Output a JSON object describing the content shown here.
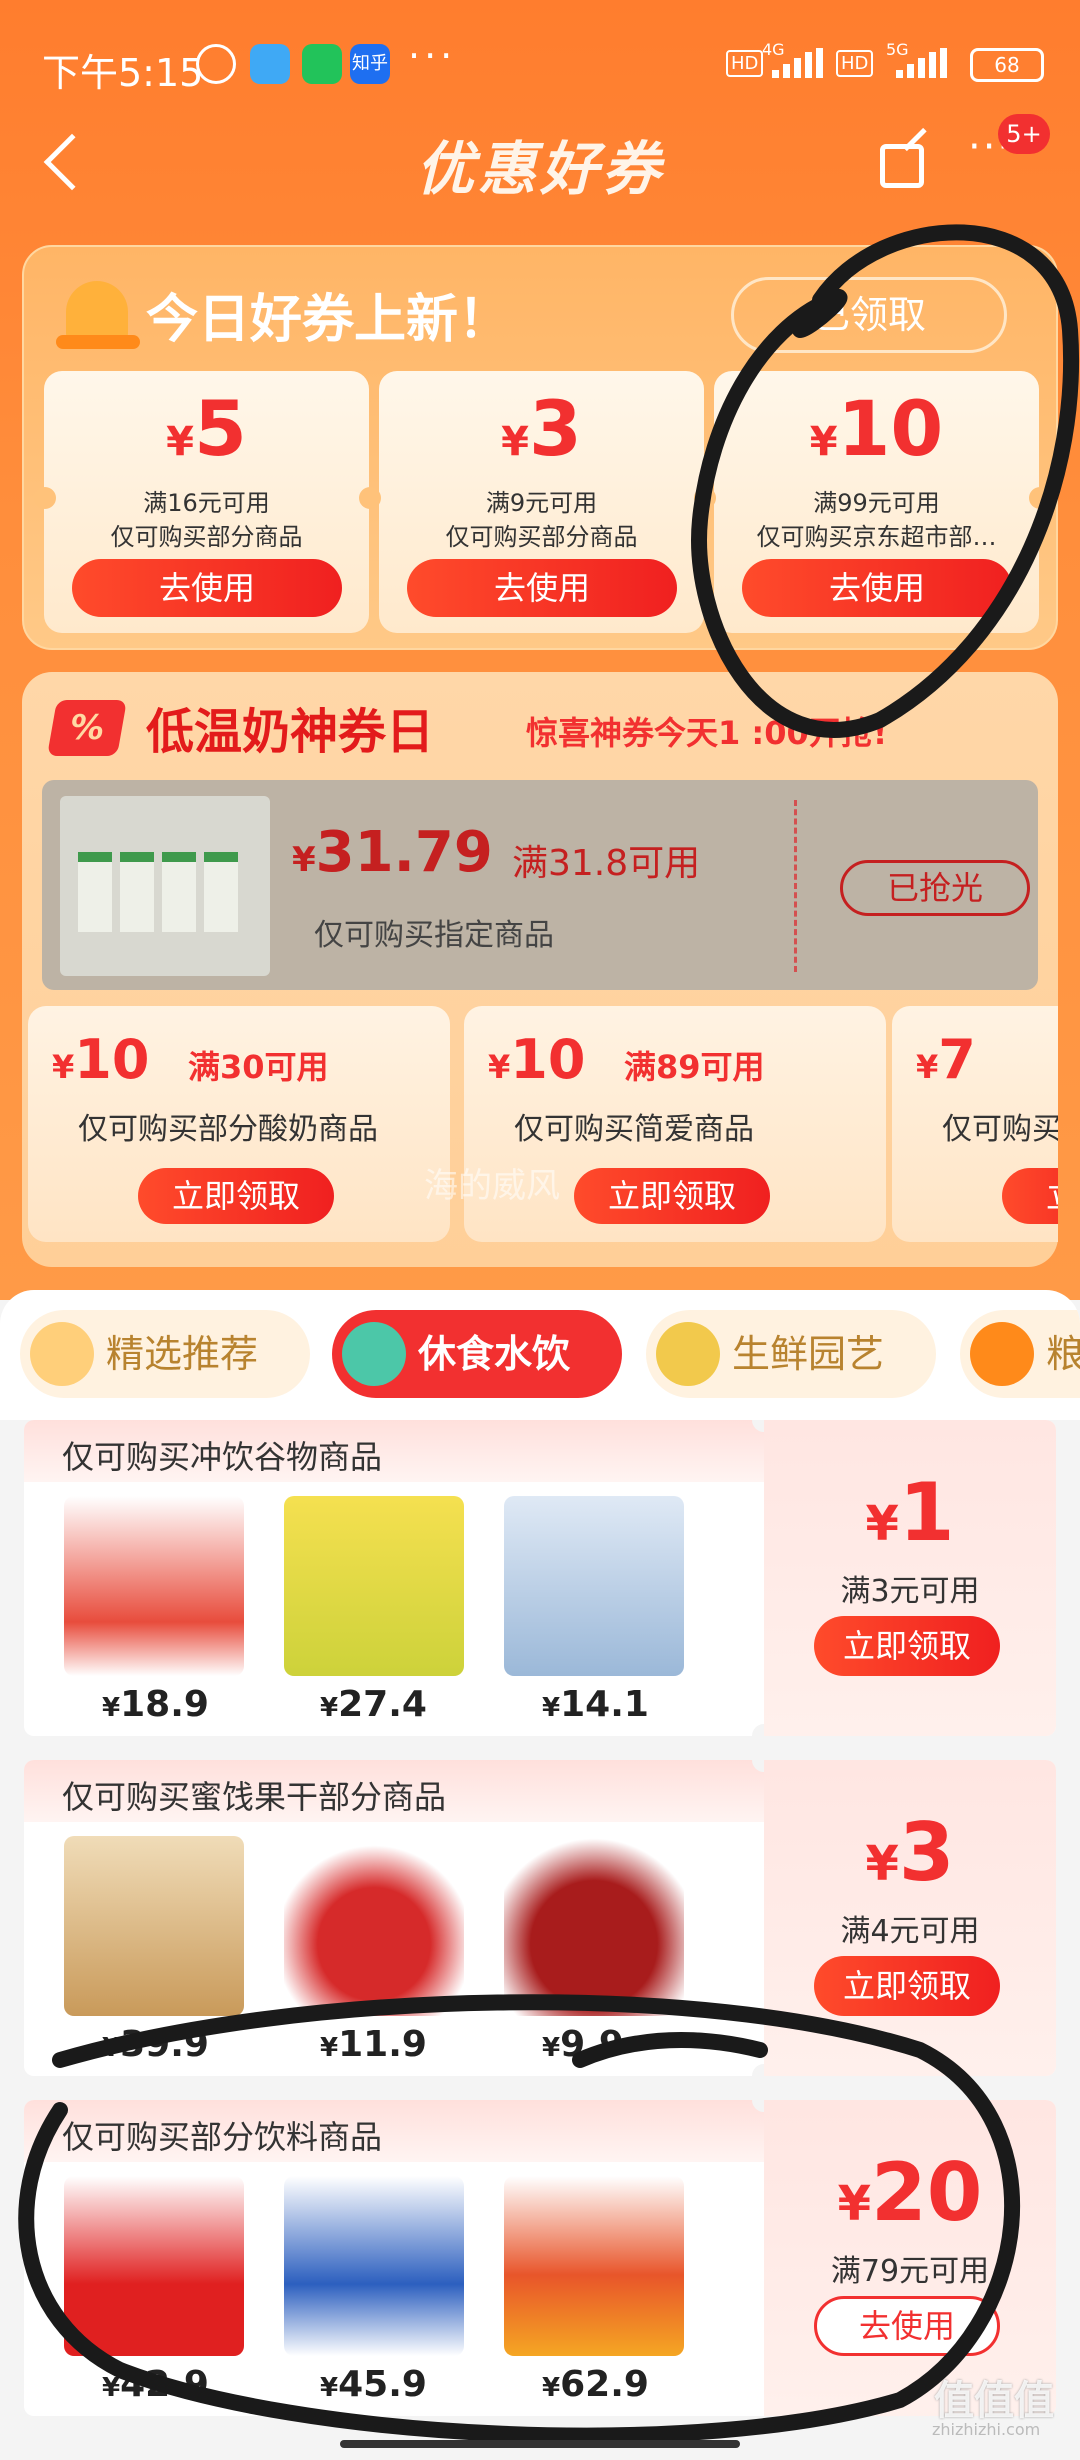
{
  "status_bar": {
    "time": "下午5:15",
    "app_icons": [
      "alarm-icon",
      "chat-bubble-icon",
      "wechat-icon",
      "zhihu-icon"
    ],
    "zhihu_label": "知乎",
    "more_dots": "···",
    "hd1": "HD",
    "net1": "4G",
    "hd2": "HD",
    "net2": "5G",
    "battery": "68"
  },
  "nav": {
    "title": "优惠好券",
    "badge": "5+",
    "more": "···"
  },
  "today": {
    "heading": "今日好券上新！",
    "claimed_button": "已领取",
    "coupons": [
      {
        "currency": "¥",
        "amount": "5",
        "condition": "满16元可用",
        "scope": "仅可购买部分商品",
        "button": "去使用"
      },
      {
        "currency": "¥",
        "amount": "3",
        "condition": "满9元可用",
        "scope": "仅可购买部分商品",
        "button": "去使用"
      },
      {
        "currency": "¥",
        "amount": "10",
        "condition": "满99元可用",
        "scope": "仅可购买京东超市部…",
        "button": "去使用"
      }
    ]
  },
  "milk_day": {
    "icon_text": "%",
    "heading": "低温奶神券日",
    "subheading": "惊喜神券今天1 :00开抢!",
    "featured": {
      "currency": "¥",
      "amount": "31.79",
      "condition": "满31.8可用",
      "scope": "仅可购买指定商品",
      "button": "已抢光"
    },
    "coupons": [
      {
        "currency": "¥",
        "amount": "10",
        "condition": "满30可用",
        "scope": "仅可购买部分酸奶商品",
        "button": "立即领取"
      },
      {
        "currency": "¥",
        "amount": "10",
        "condition": "满89可用",
        "scope": "仅可购买简爱商品",
        "button": "立即领取"
      },
      {
        "currency": "¥",
        "amount": "7",
        "condition": "",
        "scope": "仅可购买",
        "button": "立"
      }
    ]
  },
  "watermark": "海的威风",
  "tabs": [
    {
      "label": "精选推荐",
      "active": false
    },
    {
      "label": "休食水饮",
      "active": true
    },
    {
      "label": "生鲜园艺",
      "active": false
    },
    {
      "label": "粮",
      "active": false
    }
  ],
  "product_coupons": [
    {
      "title": "仅可购买冲饮谷物商品",
      "prices": [
        "18.9",
        "27.4",
        "14.1"
      ],
      "currency": "¥",
      "amount": "1",
      "condition": "满3元可用",
      "button": "立即领取"
    },
    {
      "title": "仅可购买蜜饯果干部分商品",
      "prices": [
        "39.9",
        "11.9",
        "9.9"
      ],
      "currency": "¥",
      "amount": "3",
      "condition": "满4元可用",
      "button": "立即领取"
    },
    {
      "title": "仅可购买部分饮料商品",
      "prices": [
        "42.9",
        "45.9",
        "62.9"
      ],
      "currency": "¥",
      "amount": "20",
      "condition": "满79元可用",
      "button": "去使用"
    }
  ],
  "site_mark": "值值值",
  "site_mark_url": "zhizhizhi.com"
}
